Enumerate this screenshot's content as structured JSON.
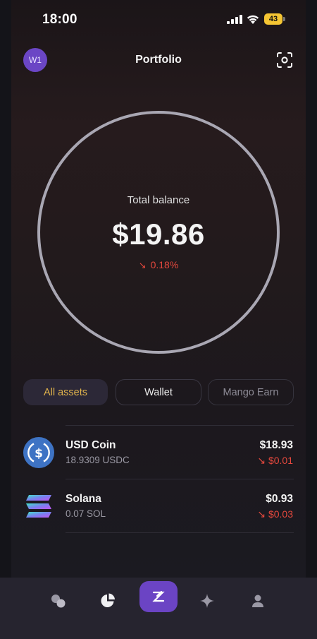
{
  "status": {
    "time": "18:00",
    "battery": "43"
  },
  "header": {
    "avatar": "W1",
    "title": "Portfolio"
  },
  "balance": {
    "label": "Total balance",
    "value": "$19.86",
    "change": "0.18%"
  },
  "filters": [
    "All assets",
    "Wallet",
    "Mango Earn"
  ],
  "assets": [
    {
      "name": "USD Coin",
      "amount": "18.9309 USDC",
      "value": "$18.93",
      "change": "$0.01"
    },
    {
      "name": "Solana",
      "amount": "0.07 SOL",
      "value": "$0.93",
      "change": "$0.03"
    }
  ],
  "nav": [
    "swap-icon",
    "portfolio-pie-icon",
    "mango-logo-icon",
    "sparkle-icon",
    "profile-icon"
  ],
  "colors": {
    "accent": "#6b44c4",
    "negative": "#e5483d",
    "tab_active_text": "#e0b34c"
  }
}
